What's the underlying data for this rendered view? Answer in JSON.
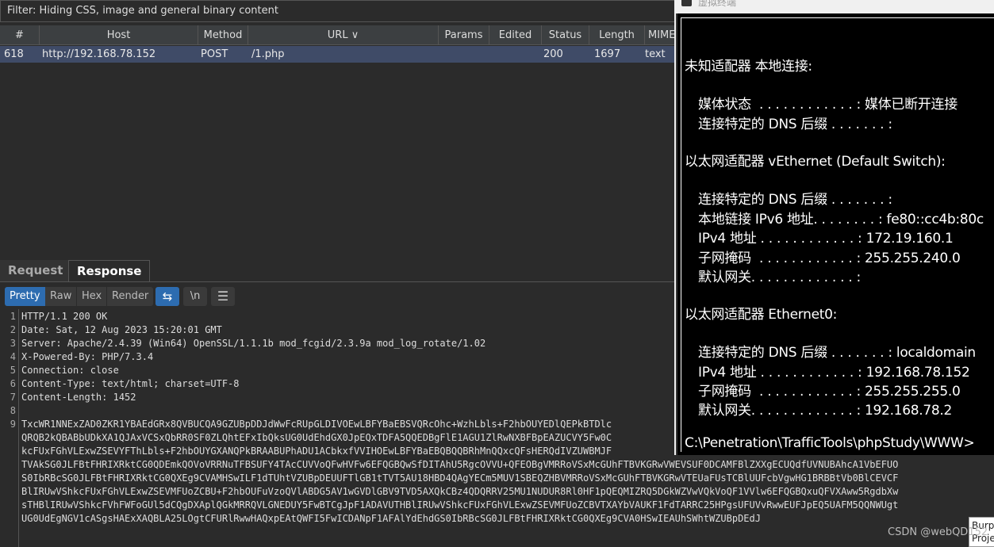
{
  "filter": "Filter: Hiding CSS, image and general binary content",
  "table": {
    "columns": [
      "#",
      "Host",
      "Method",
      "URL ∨",
      "Params",
      "Edited",
      "Status",
      "Length",
      "MIME"
    ],
    "rows": [
      {
        "num": "618",
        "host": "http://192.168.78.152",
        "method": "POST",
        "url": "/1.php",
        "params": "",
        "edited": "",
        "status": "200",
        "length": "1697",
        "mime": "text"
      }
    ]
  },
  "tabs": [
    "Request",
    "Response"
  ],
  "toolbar": {
    "pretty": "Pretty",
    "raw": "Raw",
    "hex": "Hex",
    "render": "Render",
    "newline": "\\n"
  },
  "response": {
    "lines": [
      "HTTP/1.1 200 OK",
      "Date: Sat, 12 Aug 2023 15:20:01 GMT",
      "Server: Apache/2.4.39 (Win64) OpenSSL/1.1.1b mod_fcgid/2.3.9a mod_log_rotate/1.02",
      "X-Powered-By: PHP/7.3.4",
      "Connection: close",
      "Content-Type: text/html; charset=UTF-8",
      "Content-Length: 1452",
      "",
      "TxcWR1NNExZAD0ZKR1YBAEdGRx8QVBUCQA9GZUBpDDJdWwFcRUpGLDIVOEwLBFYBaEBSVQRcOhc+WzhLbls+F2hbOUYEDlQEPkBTDlc\nQRQB2kQBABbUDkXA1QJAxVCSxQbRR0SF0ZLQhtEFxIbQksUG0UdEhdGX0JpEQxTDFA5QQEDBgFlE1AGU1ZlRwNXBFBpEAZUCVY5Fw0C\nkcFUxFGhVLExwZSEVYFThLbls+F2hbOUYGXANQPkBRAABUPhADU1ACbkxfVVIHOEwLBFYBaEBQBQQBRhMnQQxcQFsHERQdIVZUWBMJF\nTVAkSG0JLFBtFHRIXRktCG0QDEmkQOVoVRRNuTFBSUFY4TAcCUVVoQFwHVFw6EFQGBQwSfDITAhU5RgcOVVU+QFEOBgVMRRoVSxMcGUhFTBVKGRwVWEVSUF0DCAMFBlZXXgECUQdfUVNUBAhcA1VbEFUO\nS0IbRBcSG0JLFBtFHRIXRktCG0QXEg9CVAMHSwILF1dTUhtVZUBpDEUUFTlGB1tTVT5AU18HBD4QAgYECm5MUV1SBEQZHBVMRRoVSxMcGUhFTBVKGRwVTEUaFUsTCBlUUFcbVgwHG1BRBBtVb0BlCEVCF\nBlIRUwVShkcFUxFGhVLExwZSEVMFUoZCBU+F2hbOUFuVzoQVlABDG5AV1wGVDlGBV9TVD5AXQkCBz4QDQRRV25MU1NUDUR8Rl0HF1pQEQMIZRQ5DGkWZVwVQkVoQF1VVlw6EFQGBQxuQFVXAww5RgdbXw\nsTHBlIRUwVShkcFVhFWFoGUl5dCQgDXAplQGkMRRQVLGNEDUY5FwBTCgJpF1ADAVUTHBlIRUwVShkcFUxFGhVLExwZSEVMFUoZCBVTXAYbVAUKF1FdTARRC25HPgsUFUVvRwwEUFJpEQ5UAFM5QQNWUgt\nUG0UdEgNGV1cASgsHAExXAQBLA25LOgtCFURlRwwHAQxpEAtQWFI5FwICDANpF1AFAlYdEhdGS0IbRBcSG0JLFBtFHRIXRktCG0QXEg9CVA0HSwIEAUhSWhtWZUBpDEdJ"
    ]
  },
  "terminal": {
    "title": "虚拟终端",
    "lines": [
      {
        "text": "未知适配器 本地连接:",
        "indent": false
      },
      {
        "text": "媒体状态  . . . . . . . . . . . . : 媒体已断开连接",
        "indent": true
      },
      {
        "text": "连接特定的 DNS 后缀 . . . . . . . :",
        "indent": true
      },
      {
        "text": "以太网适配器 vEthernet (Default Switch):",
        "indent": false
      },
      {
        "text": "连接特定的 DNS 后缀 . . . . . . . :",
        "indent": true
      },
      {
        "text": "本地链接 IPv6 地址. . . . . . . . : fe80::cc4b:80c",
        "indent": true
      },
      {
        "text": "IPv4 地址 . . . . . . . . . . . . : 172.19.160.1",
        "indent": true
      },
      {
        "text": "子网掩码  . . . . . . . . . . . . : 255.255.240.0",
        "indent": true
      },
      {
        "text": "默认网关. . . . . . . . . . . . . :",
        "indent": true
      },
      {
        "text": "以太网适配器 Ethernet0:",
        "indent": false
      },
      {
        "text": "连接特定的 DNS 后缀 . . . . . . . : localdomain",
        "indent": true
      },
      {
        "text": "IPv4 地址 . . . . . . . . . . . . : 192.168.78.152",
        "indent": true
      },
      {
        "text": "子网掩码  . . . . . . . . . . . . : 255.255.255.0",
        "indent": true
      },
      {
        "text": "默认网关. . . . . . . . . . . . . : 192.168.78.2",
        "indent": true
      },
      {
        "text": "C:\\Penetration\\TrafficTools\\phpStudy\\WWW>",
        "indent": false
      }
    ]
  },
  "tooltip": "Burp\nProje",
  "watermark": "CSDN @webQD152",
  "colors": {
    "selected_row": "#3f4b67",
    "active_button": "#2d6cb0",
    "terminal_bg": "#000000"
  }
}
